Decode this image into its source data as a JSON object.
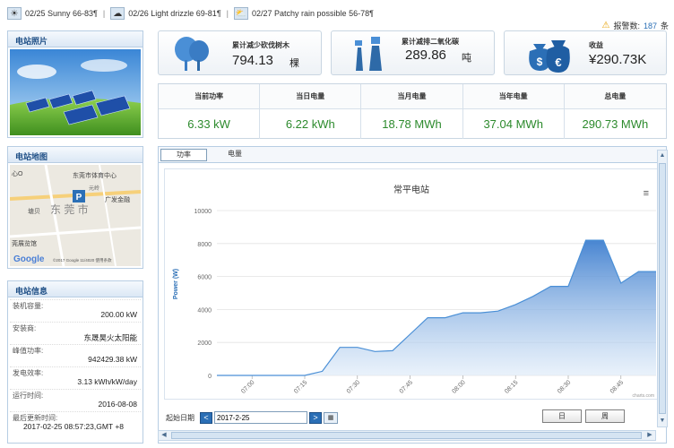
{
  "weather": [
    {
      "text": "02/25 Sunny 66-83¶",
      "icon": "sun-icon",
      "glyph": "☀"
    },
    {
      "text": "02/26 Light drizzle 69-81¶",
      "icon": "cloud-rain-icon",
      "glyph": "☁"
    },
    {
      "text": "02/27 Patchy rain possible 56-78¶",
      "icon": "cloud-sun-icon",
      "glyph": "⛅"
    }
  ],
  "alarm": {
    "label": "报警数:",
    "count": "187",
    "unit": "条"
  },
  "sidebar": {
    "photo_title": "电站照片",
    "map_title": "电站地图",
    "info_title": "电站信息",
    "map_labels": {
      "l1": "心O",
      "l2": "东莞市体育中心",
      "l3": "元岭",
      "l4": "广发金融",
      "l5": "东 莞 市",
      "l6": "塘贝",
      "l7": "莞展览馆",
      "logo": "Google",
      "attr": "©2017 Google 11/4020  使用条款"
    },
    "info": [
      {
        "label": "装机容量:",
        "value": "200.00 kW"
      },
      {
        "label": "安装商:",
        "value": "东晟昊火太阳能"
      },
      {
        "label": "峰值功率:",
        "value": "942429.38 kW"
      },
      {
        "label": "发电效率:",
        "value": "3.13 kWh/kW/day"
      },
      {
        "label": "运行时间:",
        "value": "2016-08-08"
      },
      {
        "label": "最后更新时间:",
        "value": "2017-02-25 08:57:23,GMT +8"
      }
    ]
  },
  "kpis": [
    {
      "label": "累计减少砍伐树木",
      "value": "794.13",
      "unit": "棵",
      "icon": "trees-icon"
    },
    {
      "label": "累计减排二氧化碳",
      "value": "289.86",
      "unit": "吨",
      "icon": "factory-icon"
    },
    {
      "label": "收益",
      "value": "¥290.73K",
      "unit": "",
      "icon": "money-bags-icon"
    }
  ],
  "stats": [
    {
      "label": "当前功率",
      "value": "6.33 kW"
    },
    {
      "label": "当日电量",
      "value": "6.22 kWh"
    },
    {
      "label": "当月电量",
      "value": "18.78 MWh"
    },
    {
      "label": "当年电量",
      "value": "37.04 MWh"
    },
    {
      "label": "总电量",
      "value": "290.73 MWh"
    }
  ],
  "tabs": {
    "power": "功率",
    "energy": "电量"
  },
  "controls": {
    "date_label": "起始日期",
    "date_value": "2017-2-25",
    "day": "日",
    "week": "周",
    "prev": "<",
    "next": ">",
    "credit": "charts.com"
  },
  "chart_data": {
    "type": "area",
    "title": "常平电站",
    "ylabel": "Power (W)",
    "xlabel": "",
    "ylim": [
      0,
      10000
    ],
    "yticks": [
      0,
      2000,
      4000,
      6000,
      8000,
      10000
    ],
    "xticks": [
      "07:00",
      "07:15",
      "07:30",
      "07:45",
      "08:00",
      "08:15",
      "08:30",
      "08:45"
    ],
    "x": [
      "06:50",
      "06:55",
      "07:00",
      "07:05",
      "07:10",
      "07:15",
      "07:20",
      "07:25",
      "07:30",
      "07:35",
      "07:40",
      "07:45",
      "07:50",
      "07:55",
      "08:00",
      "08:05",
      "08:10",
      "08:15",
      "08:20",
      "08:25",
      "08:30",
      "08:35",
      "08:40",
      "08:45",
      "08:50",
      "08:55"
    ],
    "values": [
      0,
      0,
      0,
      0,
      0,
      0,
      250,
      1700,
      1700,
      1450,
      1500,
      2500,
      3500,
      3500,
      3800,
      3800,
      3900,
      4300,
      4800,
      5400,
      5400,
      8200,
      8200,
      5600,
      6300,
      6300
    ],
    "color": "#5b9bd5",
    "grid": true,
    "legend": "none"
  }
}
